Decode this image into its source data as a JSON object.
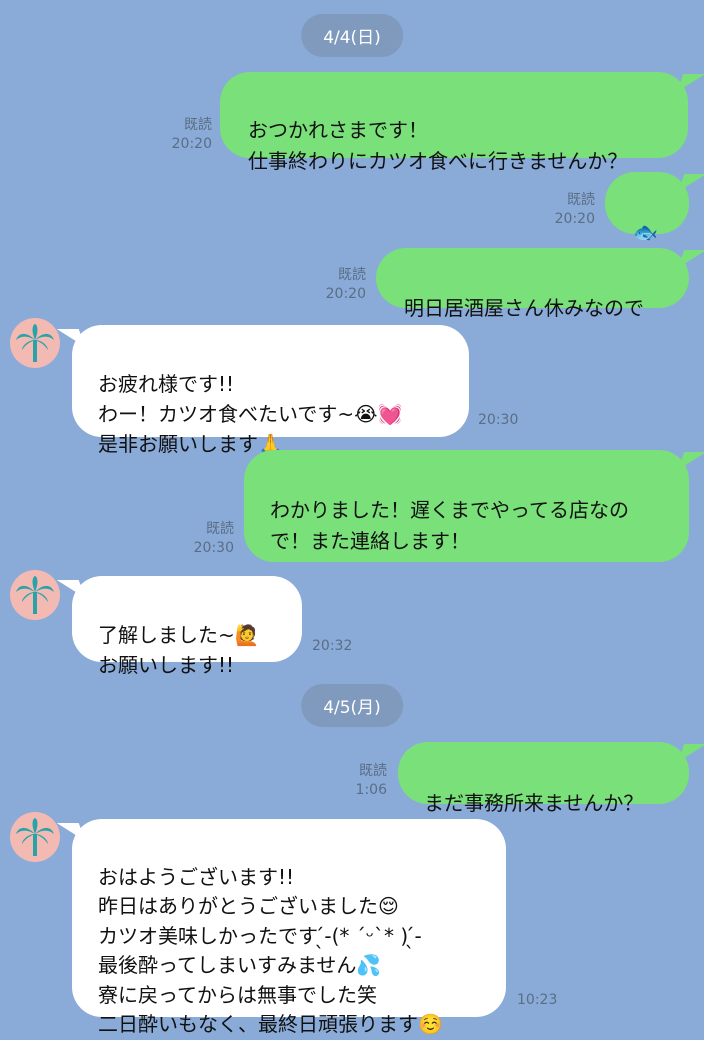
{
  "chat": {
    "dates": [
      "4/4(日)",
      "4/5(月)"
    ],
    "read_label": "既読",
    "messages": [
      {
        "text": "おつかれさまです！\n仕事終わりにカツオ食べに行きませんか？",
        "time": "20:20"
      },
      {
        "text": "🐟",
        "time": "20:20"
      },
      {
        "text": "明日居酒屋さん休みなので",
        "time": "20:20"
      },
      {
        "text": "お疲れ様です!!\nわー！カツオ食べたいです~😭💓\n是非お願いします🙏",
        "time": "20:30"
      },
      {
        "text": "わかりました！遅くまでやってる店なので！また連絡します！",
        "time": "20:30"
      },
      {
        "text": "了解しました~🙋\nお願いします!!",
        "time": "20:32"
      },
      {
        "text": "まだ事務所来ませんか？",
        "time": "1:06"
      },
      {
        "text": "おはようございます!!\n昨日はありがとうございました😌\nカツオ美味しかったです ̖́-(* ˊᵕˋ* ) ̖́-\n最後酔ってしまいすみません💦\n寮に戻ってからは無事でした笑\n二日酔いもなく、最終日頑張ります☺️",
        "time": "10:23"
      }
    ]
  },
  "colors": {
    "background": "#8aabd8",
    "outgoing_bubble": "#79e07a",
    "incoming_bubble": "#ffffff"
  }
}
